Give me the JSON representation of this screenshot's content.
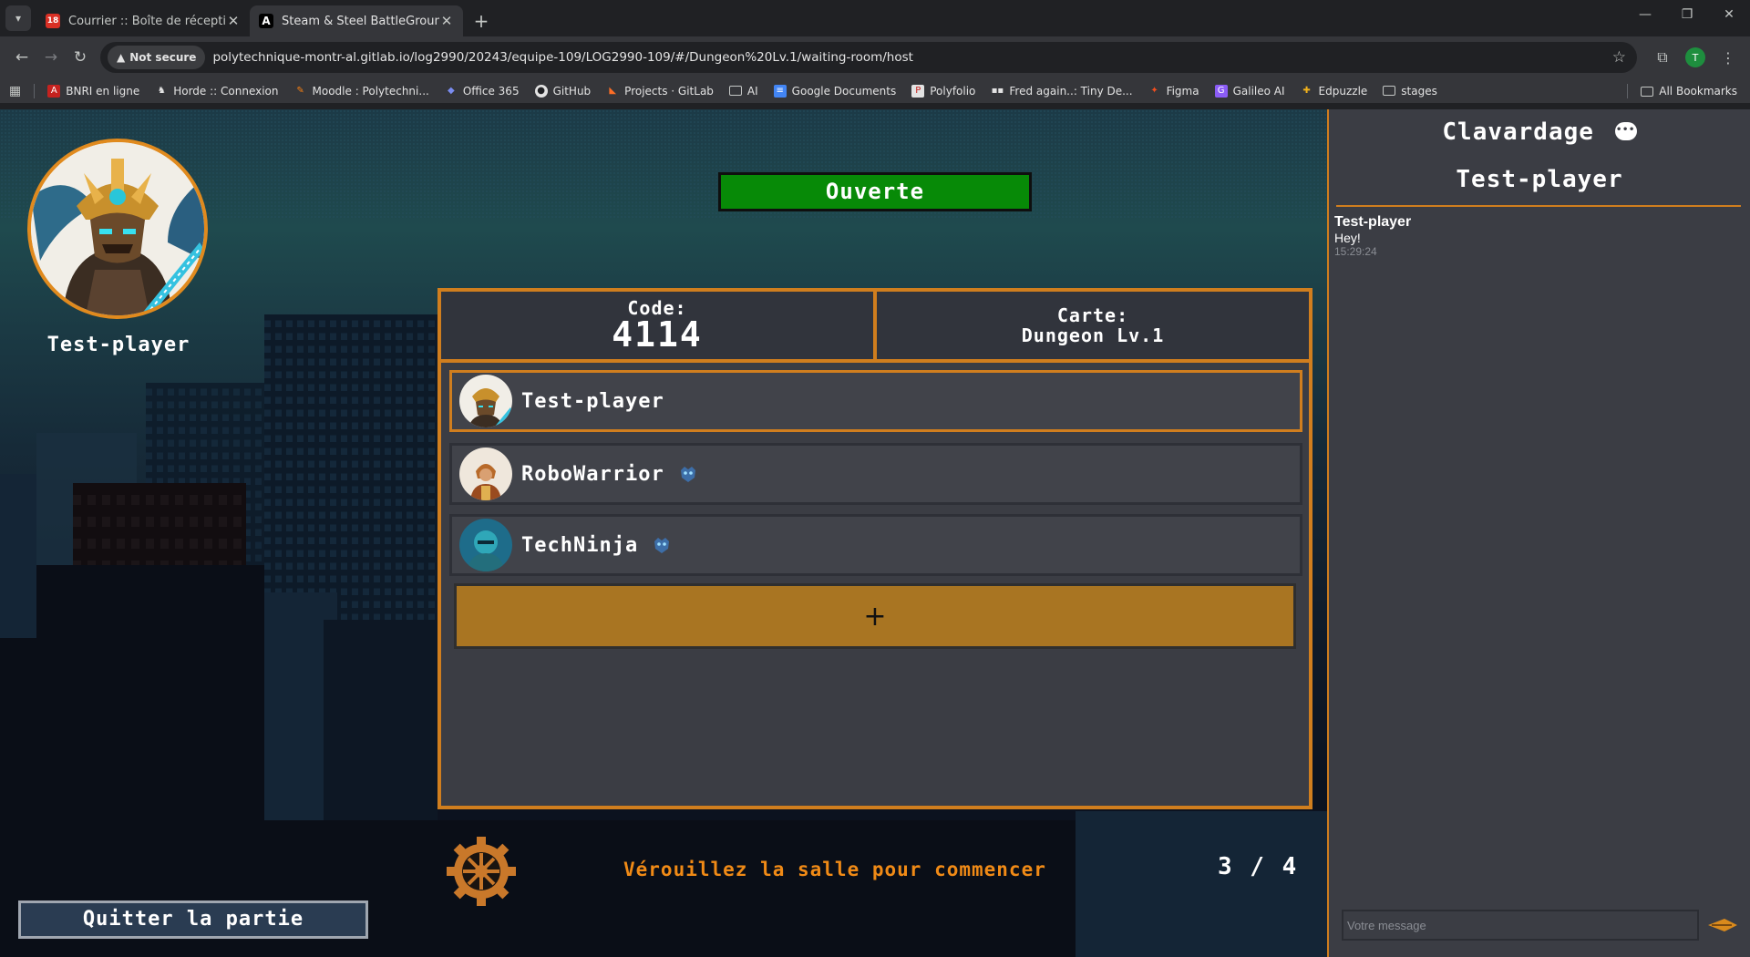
{
  "browser": {
    "tabs": [
      {
        "title": "Courrier :: Boîte de réception",
        "badge": "18"
      },
      {
        "title": "Steam & Steel BattleGrounds",
        "badge": "A"
      }
    ],
    "security_label": "Not secure",
    "url": "polytechnique-montr-al.gitlab.io/log2990/20243/equipe-109/LOG2990-109/#/Dungeon%20Lv.1/waiting-room/host",
    "profile_initial": "T",
    "bookmarks": [
      {
        "label": "BNRI en ligne"
      },
      {
        "label": "Horde :: Connexion"
      },
      {
        "label": "Moodle : Polytechni..."
      },
      {
        "label": "Office 365"
      },
      {
        "label": "GitHub"
      },
      {
        "label": "Projects · GitLab"
      },
      {
        "label": "AI"
      },
      {
        "label": "Google Documents"
      },
      {
        "label": "Polyfolio"
      },
      {
        "label": "Fred again..: Tiny De..."
      },
      {
        "label": "Figma"
      },
      {
        "label": "Galileo AI"
      },
      {
        "label": "Edpuzzle"
      },
      {
        "label": "stages"
      }
    ],
    "all_bookmarks": "All Bookmarks"
  },
  "game": {
    "player_name": "Test-player",
    "room_status": "Ouverte",
    "code_label": "Code:",
    "code_value": "4114",
    "map_label": "Carte:",
    "map_value": "Dungeon Lv.1",
    "players": [
      {
        "name": "Test-player",
        "is_self": true,
        "is_bot": false
      },
      {
        "name": "RoboWarrior",
        "is_self": false,
        "is_bot": true
      },
      {
        "name": "TechNinja",
        "is_self": false,
        "is_bot": true
      }
    ],
    "add_player_label": "+",
    "lock_message": "Vérouillez la salle pour commencer",
    "player_count": "3 / 4",
    "quit_label": "Quitter la partie",
    "colors": {
      "accent": "#d07e1e",
      "open_status": "#078a07",
      "lock_message": "#f08a16"
    }
  },
  "chat": {
    "title": "Clavardage",
    "current_user": "Test-player",
    "messages": [
      {
        "author": "Test-player",
        "text": "Hey!",
        "time": "15:29:24"
      }
    ],
    "input_placeholder": "Votre message"
  }
}
